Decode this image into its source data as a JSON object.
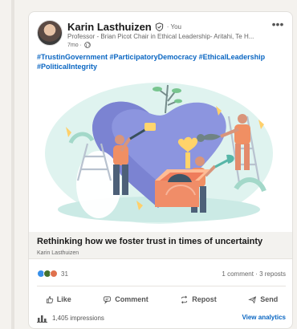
{
  "post": {
    "author_name": "Karin Lasthuizen",
    "you_tag": "· You",
    "headline": "Professor - Brian Picot Chair in Ethical Leadership- Aritahi, Te H...",
    "timestamp": "7mo ·",
    "hashtags": [
      "#TrustinGovernment",
      "#ParticipatoryDemocracy",
      "#EthicalLeadership",
      "#PoliticalIntegrity"
    ],
    "more_icon": "•••"
  },
  "article": {
    "title": "Rethinking how we foster trust in times of uncertainty",
    "author": "Karin Lasthuizen"
  },
  "social": {
    "reaction_count": "31",
    "comments_reposts": "1 comment · 3 reposts"
  },
  "actions": {
    "like": "Like",
    "comment": "Comment",
    "repost": "Repost",
    "send": "Send"
  },
  "analytics": {
    "impressions": "1,405 impressions",
    "view_analytics": "View analytics"
  },
  "colors": {
    "link_blue": "#0a66c2",
    "like_blue": "#378fe9",
    "celebrate_green": "#44712e",
    "love_red": "#df704d",
    "text_dark": "#191919"
  }
}
